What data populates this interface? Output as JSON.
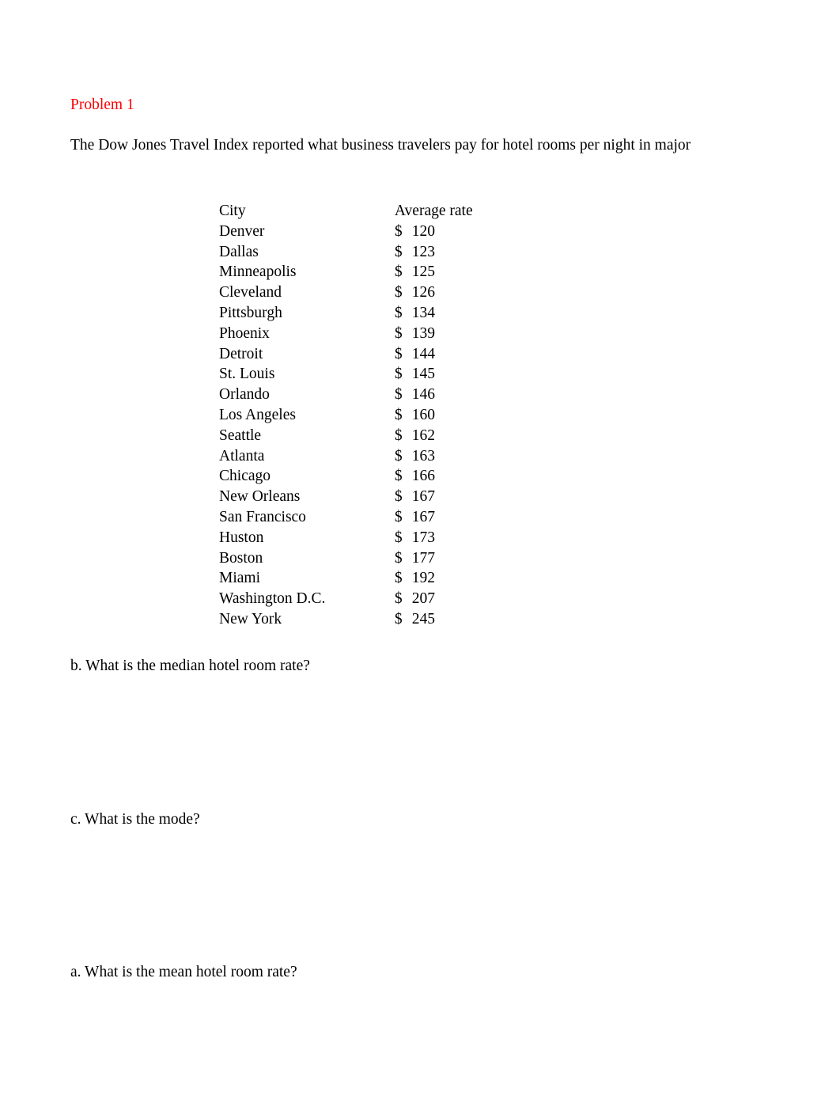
{
  "document": {
    "heading": "Problem 1",
    "heading_color": "#ff0000",
    "intro": "The Dow Jones Travel Index reported what business travelers pay for hotel rooms per night in major"
  },
  "table": {
    "headers": {
      "city": "City",
      "rate": "Average rate"
    },
    "currency_symbol": "$",
    "rows": [
      {
        "city": "Denver",
        "symbol": "$",
        "amount": "120"
      },
      {
        "city": "Dallas",
        "symbol": "$",
        "amount": "123"
      },
      {
        "city": "Minneapolis",
        "symbol": "$",
        "amount": "125"
      },
      {
        "city": "Cleveland",
        "symbol": "$",
        "amount": "126"
      },
      {
        "city": "Pittsburgh",
        "symbol": "$",
        "amount": "134"
      },
      {
        "city": "Phoenix",
        "symbol": "$",
        "amount": "139"
      },
      {
        "city": "Detroit",
        "symbol": "$",
        "amount": "144"
      },
      {
        "city": "St. Louis",
        "symbol": "$",
        "amount": "145"
      },
      {
        "city": "Orlando",
        "symbol": "$",
        "amount": "146"
      },
      {
        "city": "Los Angeles",
        "symbol": "$",
        "amount": "160"
      },
      {
        "city": "Seattle",
        "symbol": "$",
        "amount": "162"
      },
      {
        "city": "Atlanta",
        "symbol": "$",
        "amount": "163"
      },
      {
        "city": "Chicago",
        "symbol": "$",
        "amount": "166"
      },
      {
        "city": "New Orleans",
        "symbol": "$",
        "amount": "167"
      },
      {
        "city": "San Francisco",
        "symbol": "$",
        "amount": "167"
      },
      {
        "city": "Huston",
        "symbol": "$",
        "amount": "173"
      },
      {
        "city": "Boston",
        "symbol": "$",
        "amount": "177"
      },
      {
        "city": "Miami",
        "symbol": "$",
        "amount": "192"
      },
      {
        "city": "Washington D.C.",
        "symbol": "$",
        "amount": "207"
      },
      {
        "city": "New York",
        "symbol": "$",
        "amount": "245"
      }
    ]
  },
  "questions": {
    "b": "b. What is the median hotel room rate?",
    "c": "c. What is the mode?",
    "a": "a. What is the mean hotel room rate?"
  }
}
